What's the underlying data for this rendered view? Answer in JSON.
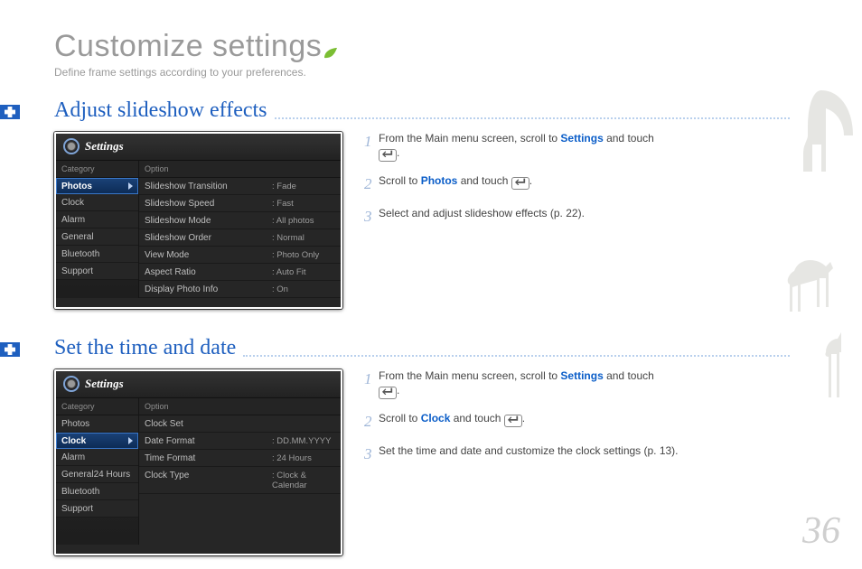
{
  "page": {
    "title": "Customize settings",
    "subtitle": "Define frame settings according to your preferences.",
    "number": "36"
  },
  "section1": {
    "heading": "Adjust slideshow effects",
    "screen": {
      "title": "Settings",
      "catLabel": "Category",
      "optLabel": "Option",
      "categories": [
        "Photos",
        "Clock",
        "Alarm",
        "General",
        "Bluetooth",
        "Support"
      ],
      "selectedCat": "Photos",
      "options": [
        {
          "k": "Slideshow Transition",
          "v": ": Fade"
        },
        {
          "k": "Slideshow Speed",
          "v": ": Fast"
        },
        {
          "k": "Slideshow Mode",
          "v": ": All photos"
        },
        {
          "k": "Slideshow Order",
          "v": ": Normal"
        },
        {
          "k": "View Mode",
          "v": ": Photo Only"
        },
        {
          "k": "Aspect Ratio",
          "v": ": Auto Fit"
        },
        {
          "k": "Display Photo Info",
          "v": ": On"
        }
      ]
    },
    "steps": {
      "s1a": "From the Main menu screen, scroll to ",
      "s1b": "Settings",
      "s1c": " and touch ",
      "s2a": "Scroll to ",
      "s2b": "Photos",
      "s2c": " and touch ",
      "s3": "Select and adjust slideshow effects (p. 22)."
    }
  },
  "section2": {
    "heading": "Set the time and date",
    "screen": {
      "title": "Settings",
      "catLabel": "Category",
      "optLabel": "Option",
      "categories": [
        "Photos",
        "Clock",
        "Alarm",
        "General24 Hours",
        "Bluetooth",
        "Support"
      ],
      "selectedCat": "Clock",
      "options": [
        {
          "k": "Clock Set",
          "v": ""
        },
        {
          "k": "Date Format",
          "v": ": DD.MM.YYYY"
        },
        {
          "k": "Time Format",
          "v": ": 24 Hours"
        },
        {
          "k": "Clock Type",
          "v": ": Clock & Calendar"
        }
      ]
    },
    "steps": {
      "s1a": "From the Main menu screen, scroll to ",
      "s1b": "Settings",
      "s1c": " and touch ",
      "s2a": "Scroll to ",
      "s2b": "Clock",
      "s2c": " and touch ",
      "s3": "Set the time and date and customize the clock settings (p. 13)."
    }
  },
  "strings": {
    "period": "."
  }
}
